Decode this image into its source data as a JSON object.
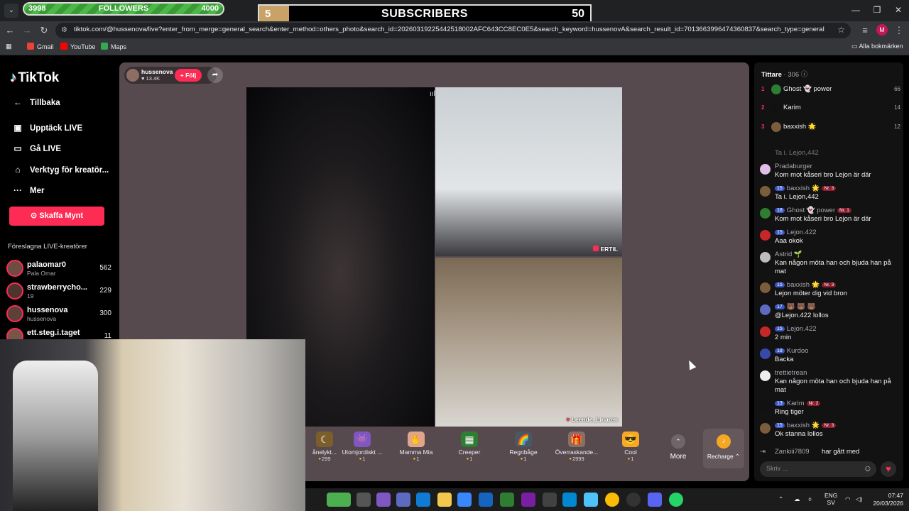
{
  "overlay": {
    "followers": {
      "current": "3998",
      "label": "FOLLOWERS",
      "goal": "4000",
      "progress": 0.9995
    },
    "subscribers": {
      "count": "5",
      "label": "SUBSCRIBERS",
      "goal": "50"
    }
  },
  "browser": {
    "url": "tiktok.com/@hussenova/live?enter_from_merge=general_search&enter_method=others_photo&search_id=20260319225442518002AFC643CC8EC0E5&search_keyword=hussenovA&search_result_id=7013663996474360837&search_type=general",
    "profile_initial": "M",
    "bookmarks": [
      {
        "label": "Gmail",
        "color": "#ea4335"
      },
      {
        "label": "YouTube",
        "color": "#ff0000"
      },
      {
        "label": "Maps",
        "color": "#34a853"
      }
    ],
    "all_bookmarks": "Alla bokmärken"
  },
  "sidebar": {
    "logo": "TikTok",
    "nav": [
      {
        "label": "Tillbaka",
        "icon": "←"
      },
      {
        "label": "Upptäck LIVE",
        "icon": "▣"
      },
      {
        "label": "Gå LIVE",
        "icon": "▭"
      },
      {
        "label": "Verktyg för kreatör...",
        "icon": "⌂"
      },
      {
        "label": "Mer",
        "icon": "···"
      }
    ],
    "coins_button": "Skaffa Mynt",
    "suggested_header": "Föreslagna LIVE-kreatörer",
    "creators": [
      {
        "name": "palaomar0",
        "sub": "Pala Omar",
        "viewers": "562"
      },
      {
        "name": "strawberrycho...",
        "sub": "19",
        "viewers": "229"
      },
      {
        "name": "hussenova",
        "sub": "hussenova",
        "viewers": "300"
      },
      {
        "name": "ett.steg.i.taget",
        "sub": "",
        "viewers": "11"
      }
    ]
  },
  "stream": {
    "host_name": "hussenova",
    "host_likes": "13.4K",
    "follow_label": "+ Följ",
    "guests": [
      {
        "label": "ERTIL"
      },
      {
        "label": "Leende_Linaren"
      }
    ]
  },
  "gifts": [
    {
      "name": "ånelykt...",
      "price": "299",
      "icon": "☾",
      "color": "#7b5e2a"
    },
    {
      "name": "Utomjordiskt ...",
      "price": "1",
      "icon": "👾",
      "color": "#7e57c2"
    },
    {
      "name": "Mamma Mia",
      "price": "1",
      "icon": "✋",
      "color": "#e0a58a"
    },
    {
      "name": "Creeper",
      "price": "1",
      "icon": "▦",
      "color": "#2e7d32"
    },
    {
      "name": "Regnbåge",
      "price": "1",
      "icon": "🌈",
      "color": "#455a64"
    },
    {
      "name": "Överraskande...",
      "price": "2999",
      "icon": "🎁",
      "color": "#8d6e63"
    },
    {
      "name": "Cool",
      "price": "1",
      "icon": "😎",
      "color": "#f9a825"
    }
  ],
  "gift_more": "More",
  "recharge": "Recharge",
  "chat": {
    "title": "Tittare",
    "viewers": "306",
    "ranking": [
      {
        "rank": "1",
        "name": "Ghost 👻 power",
        "score": "66",
        "color": "#2e7d32"
      },
      {
        "rank": "2",
        "name": "Karim",
        "score": "14",
        "color": "#111111"
      },
      {
        "rank": "3",
        "name": "baxxish 🌟",
        "score": "12",
        "color": "#7b5c3c"
      }
    ],
    "messages": [
      {
        "user": "Pradaburger",
        "level": "",
        "badge": "",
        "text": "Kom mot kåseri bro Lejon är där",
        "color": "#e1bee7"
      },
      {
        "user": "baxxish 🌟",
        "level": "15",
        "badge": "Nr. 3",
        "text": "Ta i. Lejon,442",
        "color": "#7b5c3c"
      },
      {
        "user": "Ghost 👻 power",
        "level": "18",
        "badge": "Nr. 1",
        "text": "Kom mot kåseri bro Lejon är där",
        "color": "#2e7d32"
      },
      {
        "user": "Lejon.422",
        "level": "15",
        "badge": "",
        "text": "Aaa okok",
        "color": "#c62828"
      },
      {
        "user": "Astrid 🌱",
        "level": "",
        "badge": "",
        "text": "Kan någon möta han och bjuda han på mat",
        "color": "#bdbdbd"
      },
      {
        "user": "baxxish 🌟",
        "level": "15",
        "badge": "Nr. 3",
        "text": "Lejon möter dig vid bron",
        "color": "#7b5c3c"
      },
      {
        "user": "🐻 🐻 🐻",
        "level": "17",
        "badge": "",
        "text": "@Lejon.422 lollos",
        "color": "#5c6bc0"
      },
      {
        "user": "Lejon.422",
        "level": "15",
        "badge": "",
        "text": "2 min",
        "color": "#c62828"
      },
      {
        "user": "Kurdoo",
        "level": "18",
        "badge": "",
        "text": "Backa",
        "color": "#3949ab"
      },
      {
        "user": "trettietrean",
        "level": "",
        "badge": "",
        "text": "Kan någon möta han och bjuda han på mat",
        "color": "#eeeeee"
      },
      {
        "user": "Karim",
        "level": "13",
        "badge": "Nr. 2",
        "text": "Ring tiger",
        "color": "#111111"
      },
      {
        "user": "baxxish 🌟",
        "level": "15",
        "badge": "Nr. 3",
        "text": "Ok stanna lollos",
        "color": "#7b5c3c"
      }
    ],
    "faded_top": "Ta i. Lejon,442",
    "joined": {
      "user": "Zankiii7809",
      "text": "har gått med"
    },
    "input_placeholder": "Skriv ..."
  },
  "taskbar": {
    "language": "ENG",
    "region": "SV",
    "time": "07:47",
    "date": "20/03/2026"
  }
}
